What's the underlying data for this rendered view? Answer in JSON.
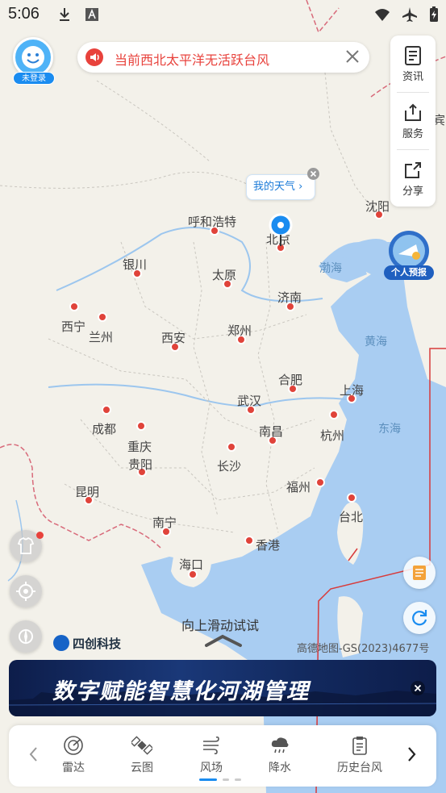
{
  "status_bar": {
    "time": "5:06"
  },
  "user": {
    "login_badge": "未登录"
  },
  "alert": {
    "text": "当前西北太平洋无活跃台风"
  },
  "side_panel": {
    "items": [
      {
        "label": "资讯"
      },
      {
        "label": "服务"
      },
      {
        "label": "分享"
      }
    ]
  },
  "my_weather": {
    "label": "我的天气"
  },
  "personal_forecast": {
    "label": "个人预报"
  },
  "map": {
    "cities": [
      {
        "name": "呼和浩特"
      },
      {
        "name": "北京"
      },
      {
        "name": "沈阳"
      },
      {
        "name": "银川"
      },
      {
        "name": "太原"
      },
      {
        "name": "济南"
      },
      {
        "name": "西宁"
      },
      {
        "name": "兰州"
      },
      {
        "name": "西安"
      },
      {
        "name": "郑州"
      },
      {
        "name": "合肥"
      },
      {
        "name": "上海"
      },
      {
        "name": "武汉"
      },
      {
        "name": "成都"
      },
      {
        "name": "南昌"
      },
      {
        "name": "杭州"
      },
      {
        "name": "重庆"
      },
      {
        "name": "贵阳"
      },
      {
        "name": "长沙"
      },
      {
        "name": "福州"
      },
      {
        "name": "昆明"
      },
      {
        "name": "台北"
      },
      {
        "name": "南宁"
      },
      {
        "name": "香港"
      },
      {
        "name": "海口"
      }
    ],
    "seas": [
      {
        "name": "渤海"
      },
      {
        "name": "黄海"
      },
      {
        "name": "东海"
      }
    ],
    "edge_label": "宾"
  },
  "swipe_hint": "向上滑动试试",
  "logo": {
    "text": "四创科技"
  },
  "copyright": "高德地图-GS(2023)4677号",
  "banner": {
    "text": "数字赋能智慧化河湖管理"
  },
  "bottom_nav": {
    "items": [
      {
        "label": "雷达"
      },
      {
        "label": "云图"
      },
      {
        "label": "风场"
      },
      {
        "label": "降水"
      },
      {
        "label": "历史台风"
      }
    ],
    "active": "风场"
  },
  "colors": {
    "accent": "#1a8cf0",
    "alert": "#e8423c",
    "sea": "#a9cdf2",
    "land": "#f3f1ea",
    "city_dot": "#e0433a",
    "typhoon_line": "#d83a3a"
  }
}
